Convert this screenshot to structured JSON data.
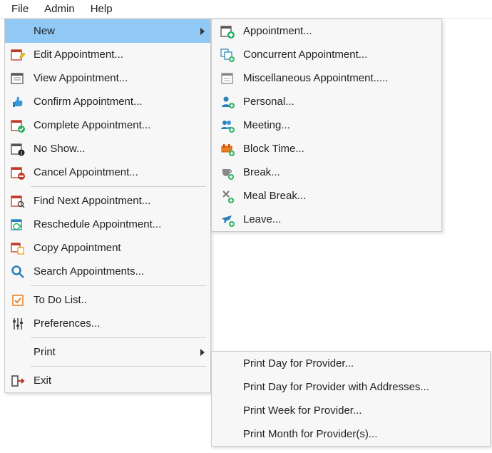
{
  "menubar": {
    "file": "File",
    "admin": "Admin",
    "help": "Help"
  },
  "fileMenu": {
    "new": "New",
    "edit": "Edit Appointment...",
    "view": "View Appointment...",
    "confirm": "Confirm Appointment...",
    "complete": "Complete Appointment...",
    "noShow": "No Show...",
    "cancel": "Cancel Appointment...",
    "findNext": "Find Next Appointment...",
    "reschedule": "Reschedule Appointment...",
    "copy": "Copy Appointment",
    "search": "Search Appointments...",
    "todo": "To Do List..",
    "preferences": "Preferences...",
    "print": "Print",
    "exit": "Exit"
  },
  "newSubmenu": {
    "appointment": "Appointment...",
    "concurrent": "Concurrent Appointment...",
    "misc": "Miscellaneous Appointment.....",
    "personal": "Personal...",
    "meeting": "Meeting...",
    "blockTime": "Block Time...",
    "break": "Break...",
    "mealBreak": "Meal Break...",
    "leave": "Leave..."
  },
  "printSubmenu": {
    "day": "Print Day for Provider...",
    "dayAddresses": "Print Day for Provider with Addresses...",
    "week": "Print Week for Provider...",
    "month": "Print Month for Provider(s)..."
  }
}
